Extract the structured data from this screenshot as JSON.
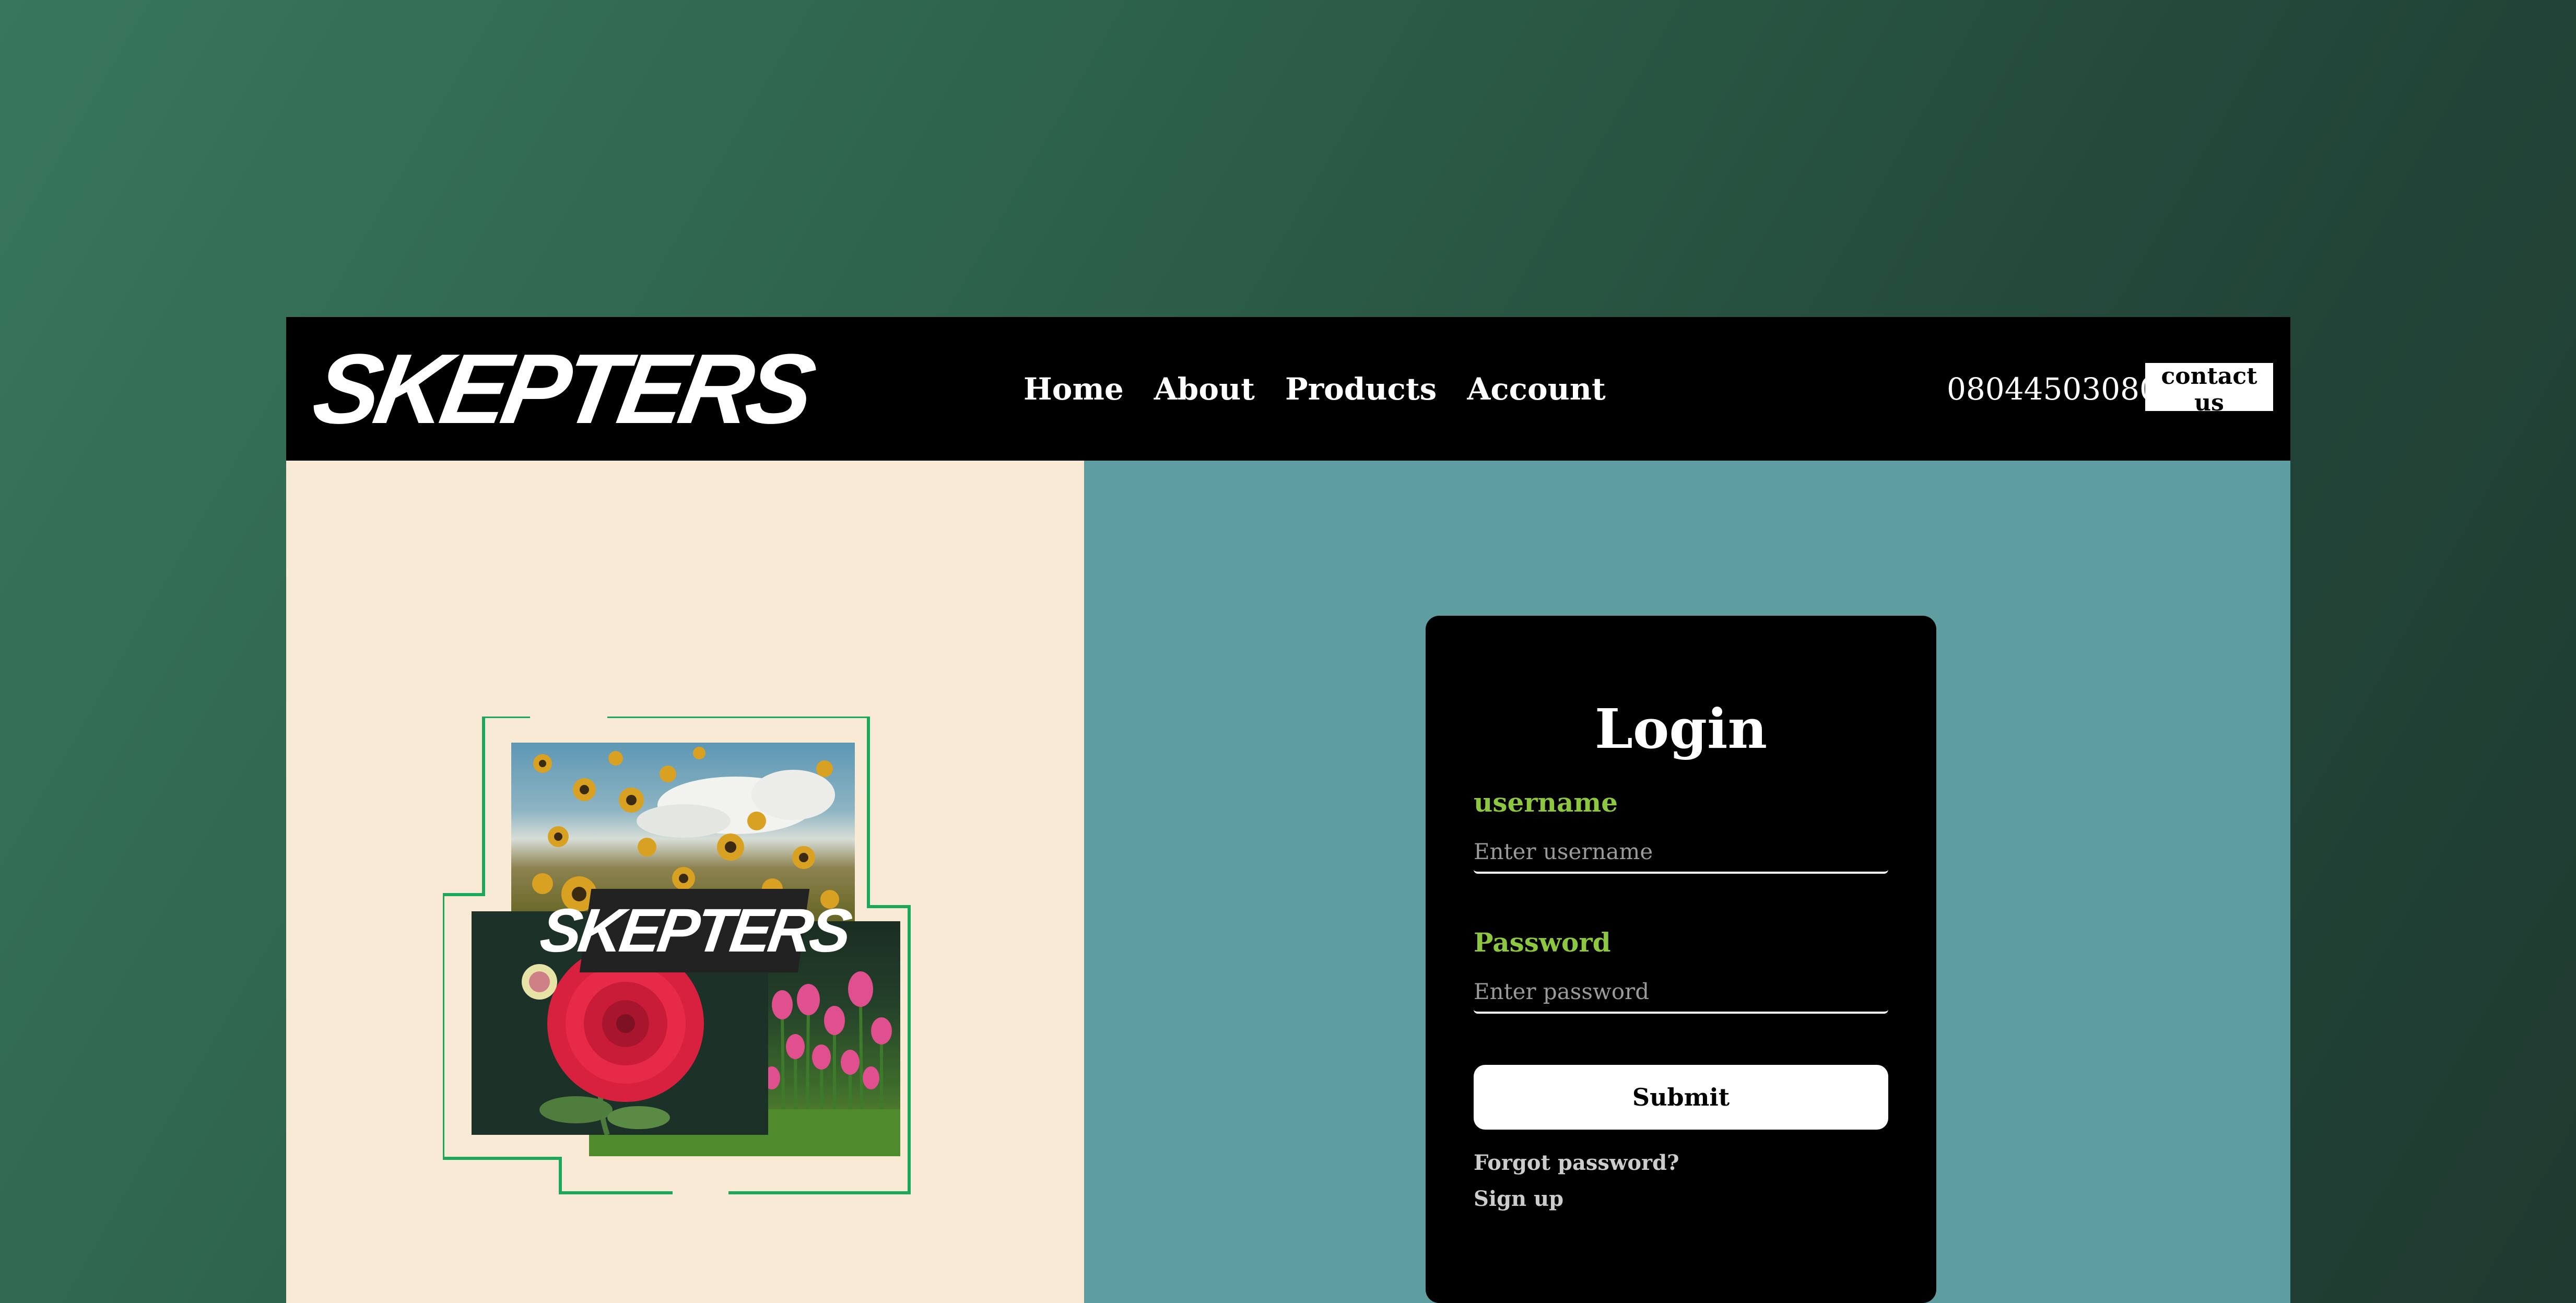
{
  "header": {
    "logo_text": "SKEPTERS",
    "nav_items": [
      {
        "label": "Home"
      },
      {
        "label": "About"
      },
      {
        "label": "Products"
      },
      {
        "label": "Account"
      }
    ],
    "phone": "08044503080",
    "contact_label": "contact us"
  },
  "collage": {
    "badge_text": "SKEPTERS",
    "photos": [
      "sunflower-field-photo",
      "tulip-field-photo",
      "red-dahlia-photo"
    ]
  },
  "login": {
    "title": "Login",
    "username_label": "username",
    "username_placeholder": "Enter username",
    "password_label": "Password",
    "password_placeholder": "Enter password",
    "submit_label": "Submit",
    "forgot_label": "Forgot password?",
    "signup_label": "Sign up"
  },
  "colors": {
    "page_gradient_start": "#38775c",
    "page_gradient_end": "#1f3a30",
    "header_bg": "#000000",
    "left_panel_bg": "#f9ead6",
    "right_panel_bg": "#5f9ea0",
    "label_green": "#8dc63f",
    "frame_green": "#1ba85a",
    "card_bg": "#000000"
  }
}
